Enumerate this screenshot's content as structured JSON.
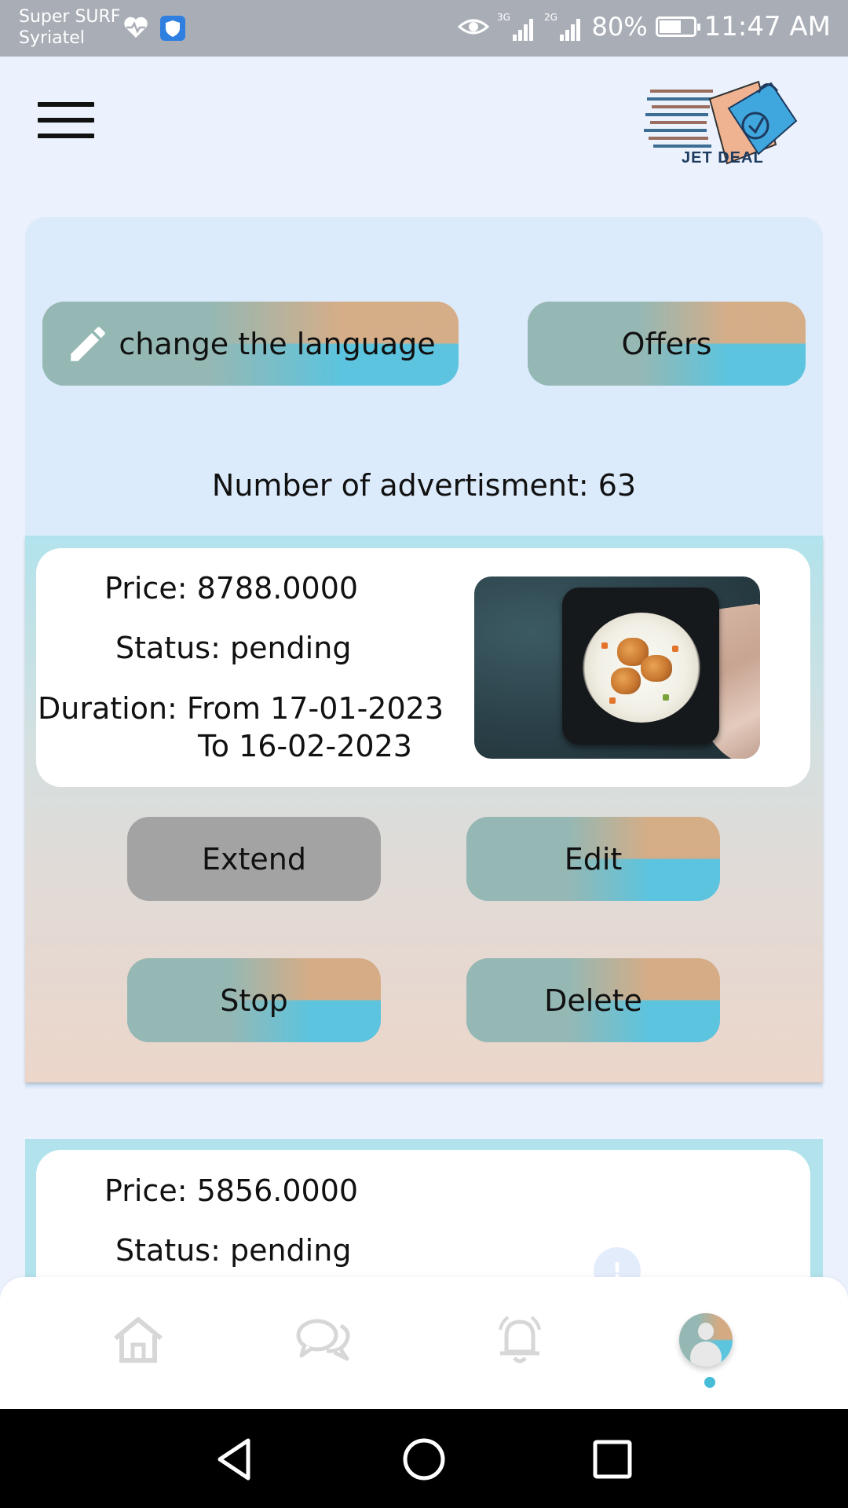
{
  "status_bar": {
    "carrier_line1": "Super SURF",
    "carrier_line2": "Syriatel",
    "network_3g": "3G",
    "network_2g": "2G",
    "battery": "80%",
    "time": "11:47 AM"
  },
  "header": {
    "logo_text": "JET DEAL"
  },
  "actions": {
    "change_language_label": "change the language",
    "offers_label": "Offers"
  },
  "ads_count_text": "Number of advertisment: 63",
  "ads": [
    {
      "price": "Price: 8788.0000",
      "status": "Status: pending",
      "duration_from": "Duration: From 17-01-2023",
      "duration_to": "To 16-02-2023",
      "buttons": {
        "extend": "Extend",
        "edit": "Edit",
        "stop": "Stop",
        "delete": "Delete"
      }
    },
    {
      "price": "Price: 5856.0000",
      "status": "Status: pending"
    }
  ],
  "bottom_nav": {
    "items": [
      "home-icon",
      "chat-icon",
      "notifications-icon",
      "profile-avatar"
    ],
    "active": "profile-avatar"
  },
  "colors": {
    "accent_blue": "#5cc4de",
    "accent_tan": "#d4aa82",
    "accent_sage": "#95b8b4",
    "extend_gray": "#a3a3a3"
  }
}
